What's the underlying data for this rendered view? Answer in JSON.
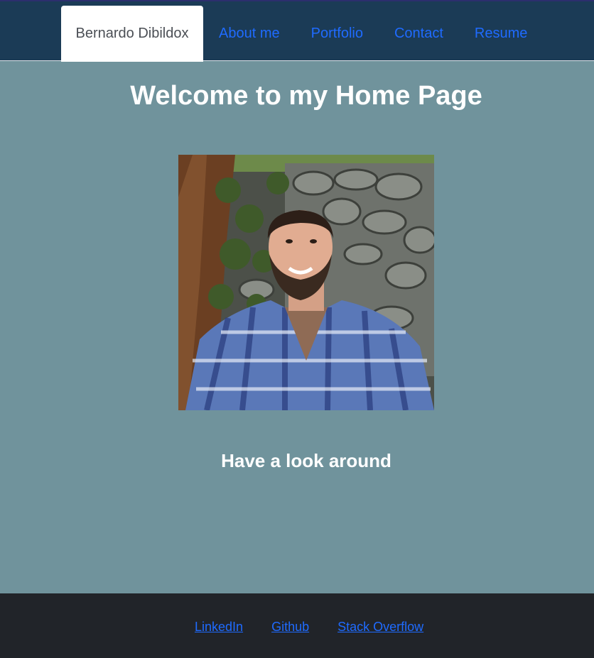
{
  "nav": {
    "brand": "Bernardo Dibildox",
    "items": [
      {
        "label": "About me"
      },
      {
        "label": "Portfolio"
      },
      {
        "label": "Contact"
      },
      {
        "label": "Resume"
      }
    ]
  },
  "main": {
    "title": "Welcome to my Home Page",
    "subtitle": "Have a look around",
    "photo_icon": "profile-photo"
  },
  "footer": {
    "links": [
      {
        "label": "LinkedIn"
      },
      {
        "label": "Github"
      },
      {
        "label": "Stack Overflow"
      }
    ]
  },
  "colors": {
    "header_bg": "#1b3b56",
    "page_bg": "#70939c",
    "footer_bg": "#212429",
    "link": "#1f6bff"
  }
}
